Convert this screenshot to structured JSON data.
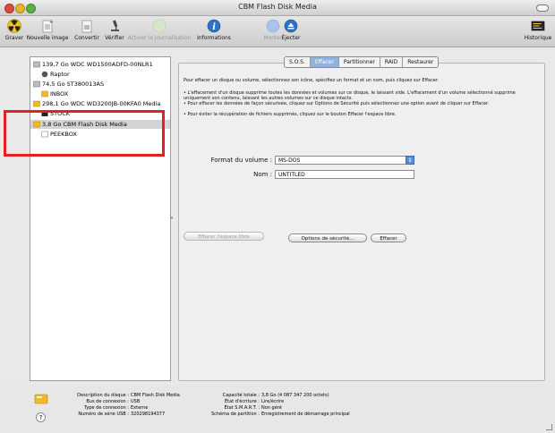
{
  "window": {
    "title": "CBM Flash Disk Media"
  },
  "toolbar": {
    "graver": "Graver",
    "nouvelle_image": "Nouvelle image",
    "convertir": "Convertir",
    "verifier": "Vérifier",
    "journalisation": "Activer la journalisation",
    "informations": "Informations",
    "monter": "Monter",
    "ejecter": "Éjecter",
    "historique": "Historique"
  },
  "sidebar": {
    "items": [
      {
        "label": "139,7 Go WDC WD1500ADFD-00NLR1",
        "icon": "internal-disk-icon"
      },
      {
        "label": "Raptor",
        "icon": "volume-icon"
      },
      {
        "label": "74,5 Go ST380013AS",
        "icon": "internal-disk-icon"
      },
      {
        "label": "INBOX",
        "icon": "volume-icon"
      },
      {
        "label": "298,1 Go WDC WD3200JB-00KFA0 Media",
        "icon": "external-disk-icon"
      },
      {
        "label": "STOCK",
        "icon": "volume-icon"
      },
      {
        "label": "3,8 Go CBM Flash Disk Media",
        "icon": "usb-disk-icon"
      },
      {
        "label": "PEEKBOX",
        "icon": "volume-icon"
      }
    ]
  },
  "tabs": [
    "S.O.S.",
    "Effacer",
    "Partitionner",
    "RAID",
    "Restaurer"
  ],
  "active_tab": "Effacer",
  "erase": {
    "intro": "Pour effacer un disque ou volume, sélectionnez son icône, spécifiez un format et un nom, puis cliquez sur Effacer.",
    "bullet1": "• L'effacement d'un disque supprime toutes les données et volumes sur ce disque, le laissant vide. L'effacement d'un volume sélectionné supprime uniquement son contenu, laissant les autres volumes sur ce disque intacts.",
    "bullet2": "• Pour effacer les données de façon sécurisée, cliquez sur Options de Sécurité puis sélectionnez une option avant de cliquer sur Effacer.",
    "bullet3": "• Pour éviter la récupération de fichiers supprimés, cliquez sur le bouton Effacer l'espace libre.",
    "format_label": "Format du volume :",
    "format_value": "MS-DOS",
    "name_label": "Nom :",
    "name_value": "UNTITLED",
    "free_space_button": "Effacer l'espace libre",
    "security_button": "Options de sécurité...",
    "erase_button": "Effacer"
  },
  "info": {
    "desc_k": "Description du disque :",
    "desc_v": "CBM Flash Disk Media",
    "bus_k": "Bus de connexion :",
    "bus_v": "USB",
    "type_k": "Type de connexion :",
    "type_v": "Externe",
    "serial_k": "Numéro de série USB :",
    "serial_v": "320298194377",
    "cap_k": "Capacité totale :",
    "cap_v": "3,8 Go (4 087 347 200 octets)",
    "write_k": "État d'écriture :",
    "write_v": "Lire/écrire",
    "smart_k": "État S.M.A.R.T. :",
    "smart_v": "Non géré",
    "part_k": "Schéma de partition :",
    "part_v": "Enregistrement de démarrage principal"
  },
  "colors": {
    "highlight": "#e22222",
    "selection": "#d4d4d4",
    "tab_active": "#8fb3e0"
  }
}
